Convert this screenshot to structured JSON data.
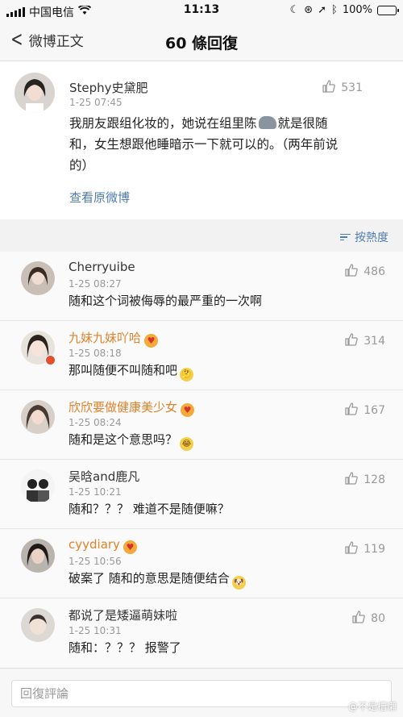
{
  "status_bar": {
    "carrier": "中国电信",
    "time": "11:13",
    "battery": "100%"
  },
  "nav": {
    "back_label": "微博正文",
    "title": "60 條回復"
  },
  "original_post": {
    "username": "Stephy史黛肥",
    "time": "1-25 07:45",
    "likes": "531",
    "text_line1_a": "我朋友跟组化妆的，她说在组里陈",
    "text_line1_b": "就是很随",
    "text_line2": "和，女生想跟他睡暗示一下就可以的。（两年前说",
    "text_line3": "的）",
    "view_original": "查看原微博"
  },
  "sort": {
    "label": "按熱度"
  },
  "comments": [
    {
      "username": "Cherryuibe",
      "time": "1-25 08:27",
      "likes": "486",
      "text": "随和这个词被侮辱的最严重的一次啊",
      "emoji": ""
    },
    {
      "username": "九妹九妹吖哈",
      "time": "1-25 08:18",
      "likes": "314",
      "text": "那叫随便不叫随和吧",
      "emoji": "🤔"
    },
    {
      "username": "欣欣要做健康美少女",
      "time": "1-25 08:24",
      "likes": "167",
      "text": "随和是这个意思吗？",
      "emoji": "😂"
    },
    {
      "username": "吴晗and鹿凡",
      "time": "1-25 10:21",
      "likes": "128",
      "text": "随和？？？ 难道不是随便嘛？",
      "emoji": ""
    },
    {
      "username": "cyydiary",
      "time": "1-25 10:56",
      "likes": "119",
      "text": "破案了 随和的意思是随便结合",
      "emoji": "🐶"
    },
    {
      "username": "都说了是矮逼萌妹啦",
      "time": "1-25 10:31",
      "likes": "80",
      "text": "随和：？？？ 报警了",
      "emoji": ""
    }
  ],
  "bottom": {
    "reply_placeholder": "回復評論",
    "watermark": "@不是槽懶"
  },
  "colors": {
    "link": "#507daf",
    "vip_name": "#e0822b",
    "muted": "#999999"
  }
}
